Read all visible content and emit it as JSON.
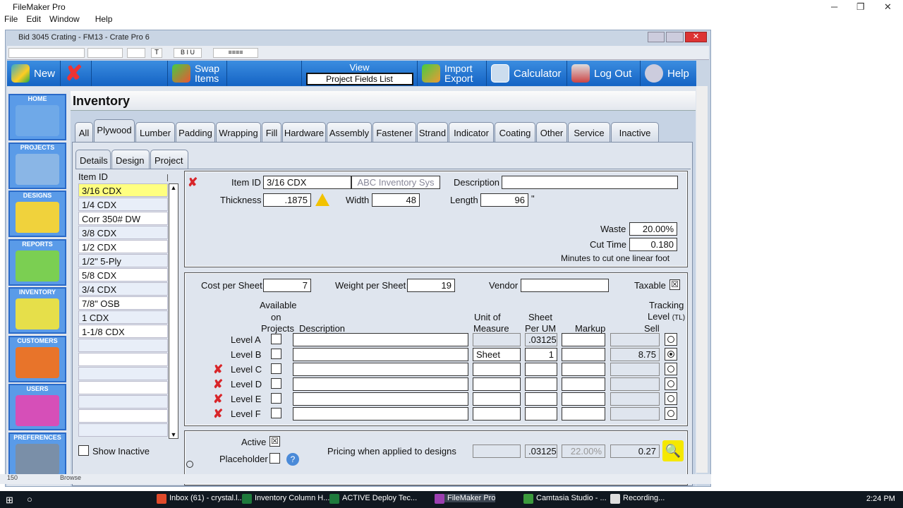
{
  "app": {
    "title": "FileMaker Pro",
    "menu": [
      "File",
      "Edit",
      "Window",
      "Help"
    ],
    "controls": [
      "─",
      "❐",
      "✕"
    ]
  },
  "window": {
    "title": "Bid 3045 Crating - FM13 - Crate Pro 6",
    "zoom": "150",
    "mode": "Browse"
  },
  "buttons": {
    "new": "New",
    "swap1": "Swap",
    "swap2": "Items",
    "view": "View",
    "view_value": "Project Fields List",
    "import1": "Import",
    "import2": "Export",
    "calculator": "Calculator",
    "logout": "Log Out",
    "help": "Help"
  },
  "sidebar": [
    {
      "label": "HOME",
      "color": "#6fa9e8"
    },
    {
      "label": "PROJECTS",
      "color": "#8ab6e6"
    },
    {
      "label": "DESIGNS",
      "color": "#f0d23c"
    },
    {
      "label": "REPORTS",
      "color": "#7bcf52"
    },
    {
      "label": "INVENTORY",
      "color": "#e6df4a"
    },
    {
      "label": "CUSTOMERS",
      "color": "#e8742a"
    },
    {
      "label": "USERS",
      "color": "#d64fb8"
    },
    {
      "label": "PREFERENCES",
      "color": "#7a8fa8"
    }
  ],
  "page_title": "Inventory",
  "tabs": [
    "All",
    "Plywood",
    "Lumber",
    "Padding",
    "Wrapping",
    "Fill",
    "Hardware",
    "Assembly",
    "Fastener",
    "Strand",
    "Indicator",
    "Coating",
    "Other",
    "Service",
    "Inactive"
  ],
  "subtabs": [
    "Details",
    "Design",
    "Project"
  ],
  "list": {
    "header": "Item ID",
    "items": [
      "3/16 CDX",
      "1/4 CDX",
      "Corr 350# DW",
      "3/8 CDX",
      "1/2 CDX",
      "1/2\" 5-Ply",
      "5/8 CDX",
      "3/4 CDX",
      "7/8\" OSB",
      "1 CDX",
      "1-1/8 CDX",
      "",
      "",
      "",
      "",
      "",
      "",
      ""
    ],
    "show_inactive": "Show Inactive"
  },
  "detail": {
    "item_id_label": "Item ID",
    "item_id": "3/16 CDX",
    "source": "ABC Inventory Sys",
    "description_label": "Description",
    "description": "",
    "thickness_label": "Thickness",
    "thickness": ".1875",
    "width_label": "Width",
    "width": "48",
    "length_label": "Length",
    "length": "96",
    "length_unit": "\"",
    "waste_label": "Waste",
    "waste": "20.00%",
    "cut_time_label": "Cut Time",
    "cut_time": "0.180",
    "cut_note": "Minutes to cut one linear foot"
  },
  "pricing": {
    "cost_label": "Cost per Sheet",
    "cost": "7",
    "weight_label": "Weight per Sheet",
    "weight": "19",
    "vendor_label": "Vendor",
    "vendor": "",
    "taxable_label": "Taxable",
    "taxable": true,
    "headers": {
      "available": "Available",
      "on": "on",
      "projects": "Projects",
      "description": "Description",
      "unit1": "Unit of",
      "unit2": "Measure",
      "sheet1": "Sheet",
      "sheet2": "Per UM",
      "markup": "Markup",
      "sell": "Sell",
      "tracking1": "Tracking",
      "tracking2": "Level",
      "tl": "(TL)"
    },
    "levels": [
      {
        "label": "Level A",
        "deletable": false,
        "available": false,
        "description": "",
        "unit": "",
        "per_um": ".03125",
        "markup": "",
        "sell": "",
        "tracking": false
      },
      {
        "label": "Level B",
        "deletable": false,
        "available": false,
        "description": "",
        "unit": "Sheet",
        "per_um": "1",
        "markup": "",
        "sell": "8.75",
        "tracking": true
      },
      {
        "label": "Level C",
        "deletable": true,
        "available": false,
        "description": "",
        "unit": "",
        "per_um": "",
        "markup": "",
        "sell": "",
        "tracking": false
      },
      {
        "label": "Level D",
        "deletable": true,
        "available": false,
        "description": "",
        "unit": "",
        "per_um": "",
        "markup": "",
        "sell": "",
        "tracking": false
      },
      {
        "label": "Level E",
        "deletable": true,
        "available": false,
        "description": "",
        "unit": "",
        "per_um": "",
        "markup": "",
        "sell": "",
        "tracking": false
      },
      {
        "label": "Level F",
        "deletable": true,
        "available": false,
        "description": "",
        "unit": "",
        "per_um": "",
        "markup": "",
        "sell": "",
        "tracking": false
      }
    ]
  },
  "footer": {
    "active_label": "Active",
    "active": true,
    "placeholder_label": "Placeholder",
    "placeholder": false,
    "pricing_label": "Pricing when applied to designs",
    "f1": "",
    "f2": ".03125",
    "f3": "22.00%",
    "f4": "0.27"
  },
  "taskbar": {
    "items": [
      {
        "label": "Inbox (61) - crystal.l...",
        "color": "#e04a2a"
      },
      {
        "label": "Inventory Column H...",
        "color": "#1e7a3c"
      },
      {
        "label": "ACTIVE Deploy Tec...",
        "color": "#1e7a3c"
      },
      {
        "label": "FileMaker Pro",
        "color": "#9c3fb0"
      },
      {
        "label": "Camtasia Studio - ...",
        "color": "#3c9a3c"
      },
      {
        "label": "Recording...",
        "color": "#ddd"
      }
    ],
    "time": "2:24 PM"
  }
}
